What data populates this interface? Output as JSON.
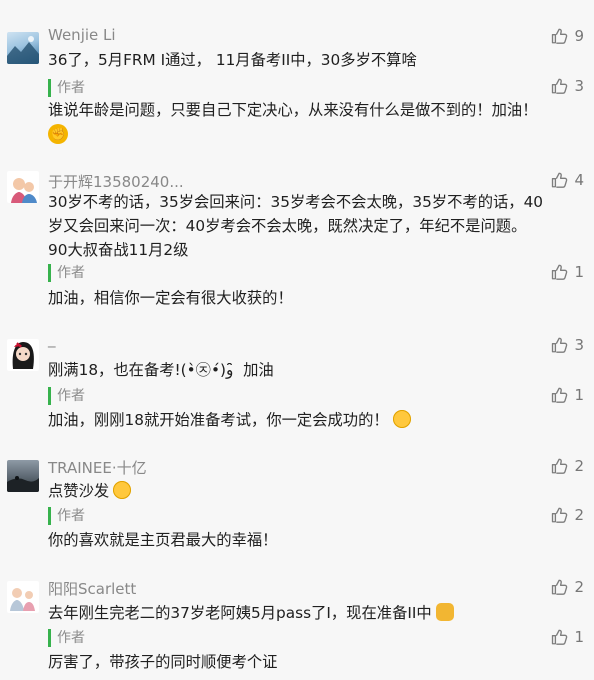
{
  "comments": [
    {
      "name": "Wenjie Li",
      "text": "36了，5月FRM I通过， 11月备考II中，30多岁不算啥",
      "likes": "9",
      "reply": {
        "tag": "作者",
        "text": "谁说年龄是问题，只要自己下定决心，从来没有什么是做不到的！加油！",
        "likes": "3",
        "emoji": "raised-fist-emoji"
      }
    },
    {
      "name": "于开辉13580240...",
      "text_lines": [
        "30岁不考的话，35岁会回来问：35岁考会不会太晚，35岁不考的话，40",
        "岁又会回来问一次：40岁考会不会太晚，既然决定了，年纪不是问题。",
        "90大叔奋战11月2级"
      ],
      "likes": "4",
      "reply": {
        "tag": "作者",
        "text": "加油，相信你一定会有很大收获的！",
        "likes": "1"
      }
    },
    {
      "name": "_",
      "text": "刚满18，也在备考!(•̀㉨•́)و ̑̑ 加油",
      "likes": "3",
      "reply": {
        "tag": "作者",
        "text": "加油，刚刚18就开始准备考试，你一定会成功的！",
        "likes": "1",
        "emoji": "hugging-face-emoji"
      }
    },
    {
      "name": "TRAINEE·十亿",
      "text": "点赞沙发",
      "emoji": "heart-eyes-emoji",
      "likes": "2",
      "reply": {
        "tag": "作者",
        "text": "你的喜欢就是主页君最大的幸福！",
        "likes": "2"
      }
    },
    {
      "name": "阳阳Scarlett",
      "text": "去年刚生完老二的37岁老阿姨5月pass了I，现在准备II中",
      "emoji": "flexed-biceps-emoji",
      "likes": "2",
      "reply": {
        "tag": "作者",
        "text": "厉害了，带孩子的同时顺便考个证",
        "likes": "1"
      }
    }
  ],
  "colors": {
    "author_bar": "#37b24d",
    "background": "#f7f7f7"
  }
}
